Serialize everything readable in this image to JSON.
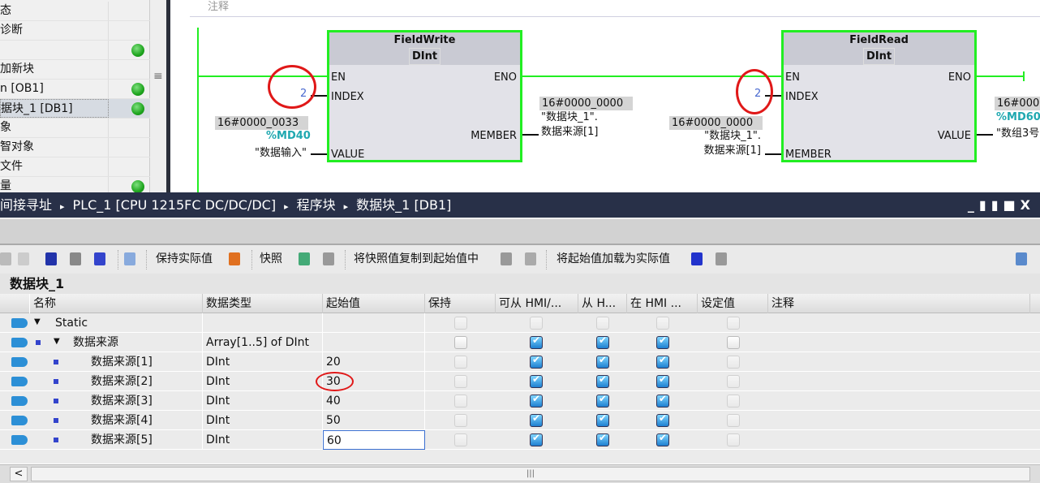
{
  "sidebar": {
    "items": [
      {
        "label": "态",
        "status": null
      },
      {
        "label": "诊断",
        "status": null
      },
      {
        "label": "",
        "status": "ok"
      },
      {
        "label": "加新块",
        "status": null
      },
      {
        "label": "n [OB1]",
        "status": "ok"
      },
      {
        "label": "据块_1 [DB1]",
        "status": "ok",
        "selected": true
      },
      {
        "label": "象",
        "status": null
      },
      {
        "label": "智对象",
        "status": null
      },
      {
        "label": "文件",
        "status": null
      },
      {
        "label": "量",
        "status": "ok"
      }
    ],
    "splitter_icon": "≡"
  },
  "ladder": {
    "comment_label": "注释",
    "fieldwrite": {
      "title": "FieldWrite",
      "type": "DInt",
      "en": "EN",
      "eno": "ENO",
      "index": "INDEX",
      "member": "MEMBER",
      "value": "VALUE",
      "index_val": "2",
      "value_hex": "16#0000_0033",
      "value_addr": "%MD40",
      "value_tag": "\"数据输入\"",
      "member_hex": "16#0000_0000",
      "member_tag1": "\"数据块_1\".",
      "member_tag2": "数据来源[1]"
    },
    "fieldread": {
      "title": "FieldRead",
      "type": "DInt",
      "en": "EN",
      "eno": "ENO",
      "index": "INDEX",
      "member": "MEMBER",
      "value": "VALUE",
      "index_val": "2",
      "member_hex": "16#0000_0000",
      "member_tag1": "\"数据块_1\".",
      "member_tag2": "数据来源[1]",
      "value_hex": "16#000",
      "value_addr": "%MD60",
      "value_tag": "\"数组3号"
    }
  },
  "titlebar": {
    "crumbs": [
      "间接寻址",
      "PLC_1 [CPU 1215FC DC/DC/DC]",
      "程序块",
      "数据块_1 [DB1]"
    ],
    "sep": "▸",
    "controls": [
      "_",
      "▮▮",
      "■",
      "X"
    ]
  },
  "toolbar": {
    "keep_actual": "保持实际值",
    "snapshot": "快照",
    "copy_snapshot": "将快照值复制到起始值中",
    "load_start": "将起始值加载为实际值"
  },
  "db_title": "数据块_1",
  "table": {
    "headers": [
      "名称",
      "数据类型",
      "起始值",
      "保持",
      "可从 HMI/...",
      "从 H...",
      "在 HMI ...",
      "设定值",
      "注释"
    ],
    "rows": [
      {
        "name": "Static",
        "type": "",
        "start": "",
        "level": 0,
        "expand": true,
        "checks": [
          0,
          0,
          0,
          0,
          0
        ],
        "dim": true
      },
      {
        "name": "数据来源",
        "type": "Array[1..5] of DInt",
        "start": "",
        "level": 1,
        "expand": true,
        "checks": [
          0,
          1,
          1,
          1,
          0
        ],
        "dim": false
      },
      {
        "name": "数据来源[1]",
        "type": "DInt",
        "start": "20",
        "level": 2,
        "checks": [
          0,
          1,
          1,
          1,
          0
        ],
        "dim": true
      },
      {
        "name": "数据来源[2]",
        "type": "DInt",
        "start": "30",
        "level": 2,
        "checks": [
          0,
          1,
          1,
          1,
          0
        ],
        "dim": true,
        "highlight": true
      },
      {
        "name": "数据来源[3]",
        "type": "DInt",
        "start": "40",
        "level": 2,
        "checks": [
          0,
          1,
          1,
          1,
          0
        ],
        "dim": true
      },
      {
        "name": "数据来源[4]",
        "type": "DInt",
        "start": "50",
        "level": 2,
        "checks": [
          0,
          1,
          1,
          1,
          0
        ],
        "dim": true
      },
      {
        "name": "数据来源[5]",
        "type": "DInt",
        "start": "60",
        "level": 2,
        "checks": [
          0,
          1,
          1,
          1,
          0
        ],
        "dim": true,
        "editing": true
      }
    ]
  },
  "scrollbar": {
    "left_arrow": "<",
    "grip": "|||"
  },
  "colors": {
    "rung": "#22ee22",
    "highlight_circle": "#e01818",
    "titlebar": "#283048"
  }
}
